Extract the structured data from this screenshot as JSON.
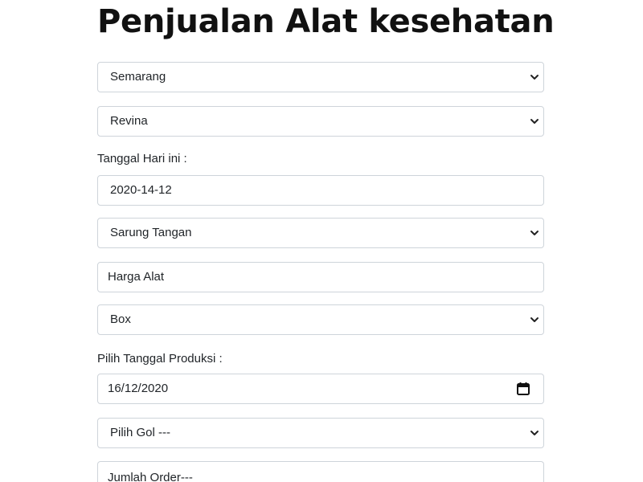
{
  "title": "Penjualan Alat kesehatan",
  "form": {
    "kota_select": "Semarang",
    "nama_select": "Revina",
    "tanggal_label": "Tanggal Hari ini :",
    "tanggal_value": "2020-14-12",
    "alat_select": "Sarung Tangan",
    "harga_placeholder": "Harga Alat",
    "satuan_select": "Box",
    "produksi_label": "Pilih Tanggal Produksi :",
    "produksi_date": "16/12/2020",
    "gol_select": "Pilih Gol ---",
    "jumlah_placeholder": "Jumlah Order---"
  },
  "icons": {
    "select": "chevron-down-icon",
    "date": "calendar-icon"
  }
}
